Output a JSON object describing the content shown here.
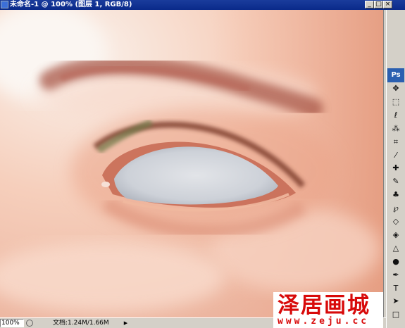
{
  "window": {
    "title": "未命名-1 @ 100% (图层 1, RGB/8)",
    "minimize_label": "_",
    "maximize_label": "□",
    "close_label": "×"
  },
  "toolbox": {
    "logo": "Ps",
    "tools": [
      {
        "name": "move-tool-icon",
        "glyph": "✥"
      },
      {
        "name": "marquee-tool-icon",
        "glyph": "⬚"
      },
      {
        "name": "lasso-tool-icon",
        "glyph": "ℓ"
      },
      {
        "name": "magic-wand-tool-icon",
        "glyph": "⁂"
      },
      {
        "name": "crop-tool-icon",
        "glyph": "⌗"
      },
      {
        "name": "slice-tool-icon",
        "glyph": "⁄"
      },
      {
        "name": "healing-brush-tool-icon",
        "glyph": "✚"
      },
      {
        "name": "brush-tool-icon",
        "glyph": "✎"
      },
      {
        "name": "clone-stamp-tool-icon",
        "glyph": "♣"
      },
      {
        "name": "history-brush-tool-icon",
        "glyph": "℘"
      },
      {
        "name": "eraser-tool-icon",
        "glyph": "◇"
      },
      {
        "name": "paint-bucket-tool-icon",
        "glyph": "◈"
      },
      {
        "name": "blur-tool-icon",
        "glyph": "△"
      },
      {
        "name": "dodge-tool-icon",
        "glyph": "●"
      },
      {
        "name": "pen-tool-icon",
        "glyph": "✒"
      },
      {
        "name": "type-tool-icon",
        "glyph": "T"
      },
      {
        "name": "path-selection-tool-icon",
        "glyph": "➤"
      },
      {
        "name": "shape-tool-icon",
        "glyph": "□"
      }
    ]
  },
  "statusbar": {
    "zoom": "100%",
    "doc_info": "文档:1.24M/1.66M",
    "left_arrow": "◀",
    "right_arrow": "▶"
  },
  "watermark": {
    "name": "泽居画城",
    "url": "www.zeju.cc"
  },
  "colors": {
    "skin": "#f6d2c0",
    "eyelid": "#c9705a",
    "sclera": "#d2d6dc",
    "brow": "#a9584a",
    "watermark_red": "#d80a0a"
  }
}
